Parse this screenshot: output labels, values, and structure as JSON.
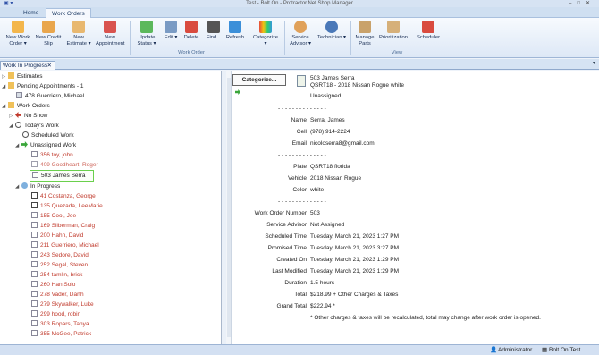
{
  "window": {
    "title": "Test - Bolt On - Protractor.Net Shop Manager"
  },
  "tabs": [
    {
      "label": "Home"
    },
    {
      "label": "Work Orders"
    }
  ],
  "ribbon": {
    "buttons": [
      {
        "label": "New Work Order ▾",
        "icon": "new-work-order-icon"
      },
      {
        "label": "New Credit Slip",
        "icon": "credit-slip-icon"
      },
      {
        "label": "New Estimate ▾",
        "icon": "estimate-icon"
      },
      {
        "label": "New Appointment",
        "icon": "calendar-icon"
      },
      {
        "label": "Update Status ▾",
        "icon": "update-status-icon"
      },
      {
        "label": "Edit ▾",
        "icon": "edit-icon"
      },
      {
        "label": "Delete",
        "icon": "delete-icon"
      },
      {
        "label": "Find...",
        "icon": "binoculars-icon"
      },
      {
        "label": "Refresh",
        "icon": "refresh-icon"
      },
      {
        "label": "Categorize ▾",
        "icon": "categorize-icon"
      },
      {
        "label": "Service Advisor ▾",
        "icon": "service-advisor-icon"
      },
      {
        "label": "Technician ▾",
        "icon": "technician-icon"
      },
      {
        "label": "Manage Parts",
        "icon": "manage-parts-icon"
      },
      {
        "label": "Prioritization",
        "icon": "prioritization-icon"
      },
      {
        "label": "Scheduler",
        "icon": "scheduler-icon"
      }
    ],
    "groups": [
      {
        "label": "Work Order"
      },
      {
        "label": "View"
      }
    ]
  },
  "doc_tab": {
    "label": "Work In Progress",
    "close": "✕"
  },
  "tree": [
    {
      "label": "Estimates",
      "color": "dark"
    },
    {
      "label": "Pending Appointments - 1",
      "color": "dark"
    },
    {
      "label": "478 Guerriero, Michael",
      "color": "dark"
    },
    {
      "label": "Work Orders",
      "color": "dark"
    },
    {
      "label": "No Show",
      "color": "dark"
    },
    {
      "label": "Today's Work",
      "color": "dark"
    },
    {
      "label": "Scheduled Work",
      "color": "dark"
    },
    {
      "label": "Unassigned Work",
      "color": "dark"
    },
    {
      "label": "356 toy, john",
      "color": "red"
    },
    {
      "label": "409 Goodheart, Roger",
      "color": "red"
    },
    {
      "label": "503 James Serra",
      "color": "dark"
    },
    {
      "label": "In Progress",
      "color": "dark"
    },
    {
      "label": "41 Costanza, George",
      "color": "red"
    },
    {
      "label": "135 Quezada, LeeMarie",
      "color": "red"
    },
    {
      "label": "155 Cool, Joe",
      "color": "red"
    },
    {
      "label": "169 Silberman, Craig",
      "color": "red"
    },
    {
      "label": "200 Hahn, David",
      "color": "red"
    },
    {
      "label": "211 Guerriero, Michael",
      "color": "red"
    },
    {
      "label": "243 Sedore, David",
      "color": "red"
    },
    {
      "label": "252 Segal, Steven",
      "color": "red"
    },
    {
      "label": "254 tamlin, brick",
      "color": "red"
    },
    {
      "label": "260 Han Solo",
      "color": "red"
    },
    {
      "label": "278 Vader, Darth",
      "color": "red"
    },
    {
      "label": "279 Skywalker, Luke",
      "color": "red"
    },
    {
      "label": "299 hood, robin",
      "color": "red"
    },
    {
      "label": "303 Ropars, Tanya",
      "color": "red"
    },
    {
      "label": "355 McGee, Patrick",
      "color": "red"
    }
  ],
  "detail": {
    "categorize_label": "Categorize...",
    "header_line1": "503 James Serra",
    "header_line2": "QSRT18 - 2018 Nissan Rogue white",
    "header_line3": "Unassigned",
    "divider": "- - - -     - - - - - - - - - -",
    "fields": [
      {
        "key": "Name",
        "value": "Serra, James"
      },
      {
        "key": "Cell",
        "value": "(978) 914-2224"
      },
      {
        "key": "Email",
        "value": "nicoloserra8@gmail.com"
      },
      {
        "key": "Plate",
        "value": "QSRT18 florida"
      },
      {
        "key": "Vehicle",
        "value": "2018 Nissan Rogue"
      },
      {
        "key": "Color",
        "value": "white"
      },
      {
        "key": "Work Order Number",
        "value": "503"
      },
      {
        "key": "Service Advisor",
        "value": "Not Assigned"
      },
      {
        "key": "Scheduled Time",
        "value": "Tuesday, March 21, 2023 1:27 PM"
      },
      {
        "key": "Promised Time",
        "value": "Tuesday, March 21, 2023 3:27 PM"
      },
      {
        "key": "Created On",
        "value": "Tuesday, March 21, 2023 1:29 PM"
      },
      {
        "key": "Last Modified",
        "value": "Tuesday, March 21, 2023 1:29 PM"
      },
      {
        "key": "Duration",
        "value": "1.5 hours"
      },
      {
        "key": "Total",
        "value": "$218.99 + Other Charges & Taxes"
      },
      {
        "key": "Grand Total",
        "value": "$222.94 *"
      }
    ],
    "footnote": "* Other charges & taxes will be recalculated, total may change after work order is opened."
  },
  "status": {
    "user": "Administrator",
    "test": "Bolt On Test"
  }
}
